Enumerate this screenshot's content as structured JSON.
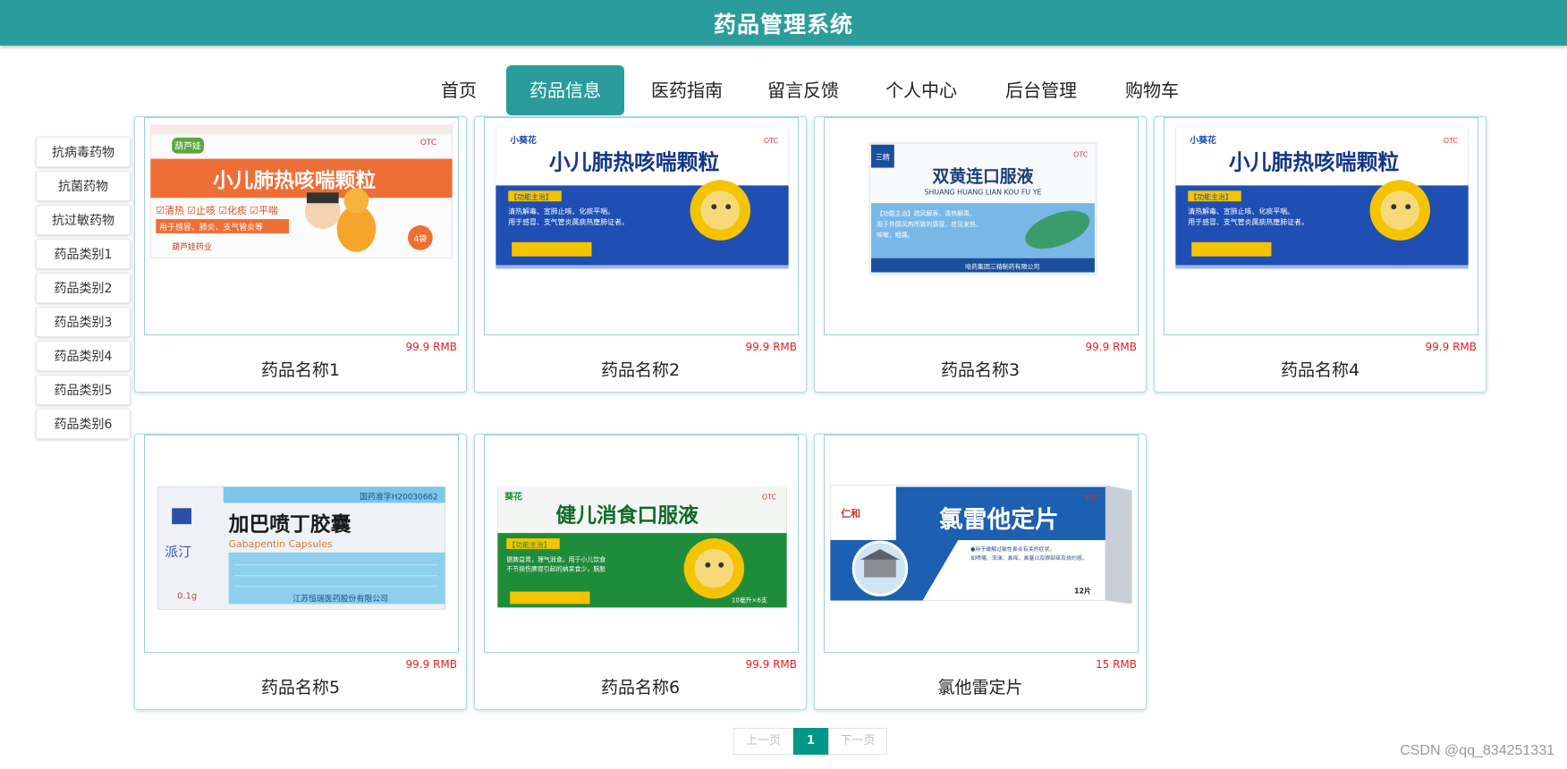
{
  "header": {
    "title": "药品管理系统"
  },
  "nav": {
    "items": [
      {
        "label": "首页"
      },
      {
        "label": "药品信息"
      },
      {
        "label": "医药指南"
      },
      {
        "label": "留言反馈"
      },
      {
        "label": "个人中心"
      },
      {
        "label": "后台管理"
      },
      {
        "label": "购物车"
      }
    ],
    "active": "药品信息"
  },
  "sidebar": {
    "items": [
      {
        "label": "抗病毒药物"
      },
      {
        "label": "抗菌药物"
      },
      {
        "label": "抗过敏药物"
      },
      {
        "label": "药品类别1"
      },
      {
        "label": "药品类别2"
      },
      {
        "label": "药品类别3"
      },
      {
        "label": "药品类别4"
      },
      {
        "label": "药品类别5"
      },
      {
        "label": "药品类别6"
      }
    ]
  },
  "products": [
    {
      "name": "药品名称1",
      "price": "99.9 RMB",
      "image": {
        "brand": "葫芦娃",
        "title": "小儿肺热咳喘颗粒",
        "tags": "☑清热 ☑止咳 ☑化痰 ☑平喘",
        "note": "用于感冒、肺炎、支气管炎等",
        "maker": "葫芦娃药业",
        "badge": "OTC",
        "count": "4袋"
      }
    },
    {
      "name": "药品名称2",
      "price": "99.9 RMB",
      "image": {
        "brand": "小葵花",
        "title": "小儿肺热咳喘颗粒",
        "panel": "【功能主治】",
        "text1": "清热解毒、宣肺止咳、化痰平喘。",
        "text2": "用于感冒、支气管炎属痰热壅肺证者。",
        "badge": "OTC"
      }
    },
    {
      "name": "药品名称3",
      "price": "99.9 RMB",
      "image": {
        "brand": "三精",
        "title": "双黄连口服液",
        "subtitle": "SHUANG HUANG LIAN KOU FU YE",
        "text1": "【功能主治】疏风解表，清热解毒。",
        "text2": "用于外感风热所致的感冒，症见发热，",
        "text3": "咳嗽，咽痛。",
        "maker": "哈药集团三精制药有限公司",
        "badge": "OTC"
      }
    },
    {
      "name": "药品名称4",
      "price": "99.9 RMB",
      "image": {
        "brand": "小葵花",
        "title": "小儿肺热咳喘颗粒",
        "panel": "【功能主治】",
        "text1": "清热解毒、宣肺止咳、化痰平喘。",
        "text2": "用于感冒、支气管炎属痰热壅肺证者。",
        "badge": "OTC"
      }
    },
    {
      "name": "药品名称5",
      "price": "99.9 RMB",
      "image": {
        "approval": "国药准字H20030662",
        "brand": "派汀",
        "title": "加巴喷丁胶囊",
        "subtitle": "Gabapentin Capsules",
        "dose": "0.1g",
        "maker": "江苏恒瑞医药股份有限公司"
      }
    },
    {
      "name": "药品名称6",
      "price": "99.9 RMB",
      "image": {
        "brand": "葵花",
        "title": "健儿消食口服液",
        "panel": "【功能主治】",
        "text1": "健脾益胃，理气消食。用于小儿饮食",
        "text2": "不节损伤脾胃引起的纳呆食少，脘胀",
        "badge": "OTC",
        "count": "10毫升×6支"
      }
    },
    {
      "name": "氯他雷定片",
      "price": "15 RMB",
      "image": {
        "brand": "仁和",
        "title": "氯雷他定片",
        "text1": "●用于缓解过敏性鼻炎有关的症状，",
        "text2": "如喷嚏、流涕、鼻痒、鼻塞以及眼部痒及烧灼感。",
        "count": "12片",
        "badge": "OTC"
      }
    }
  ],
  "pagination": {
    "prev": "上一页",
    "current": "1",
    "next": "下一页"
  },
  "watermark": "CSDN @qq_834251331"
}
